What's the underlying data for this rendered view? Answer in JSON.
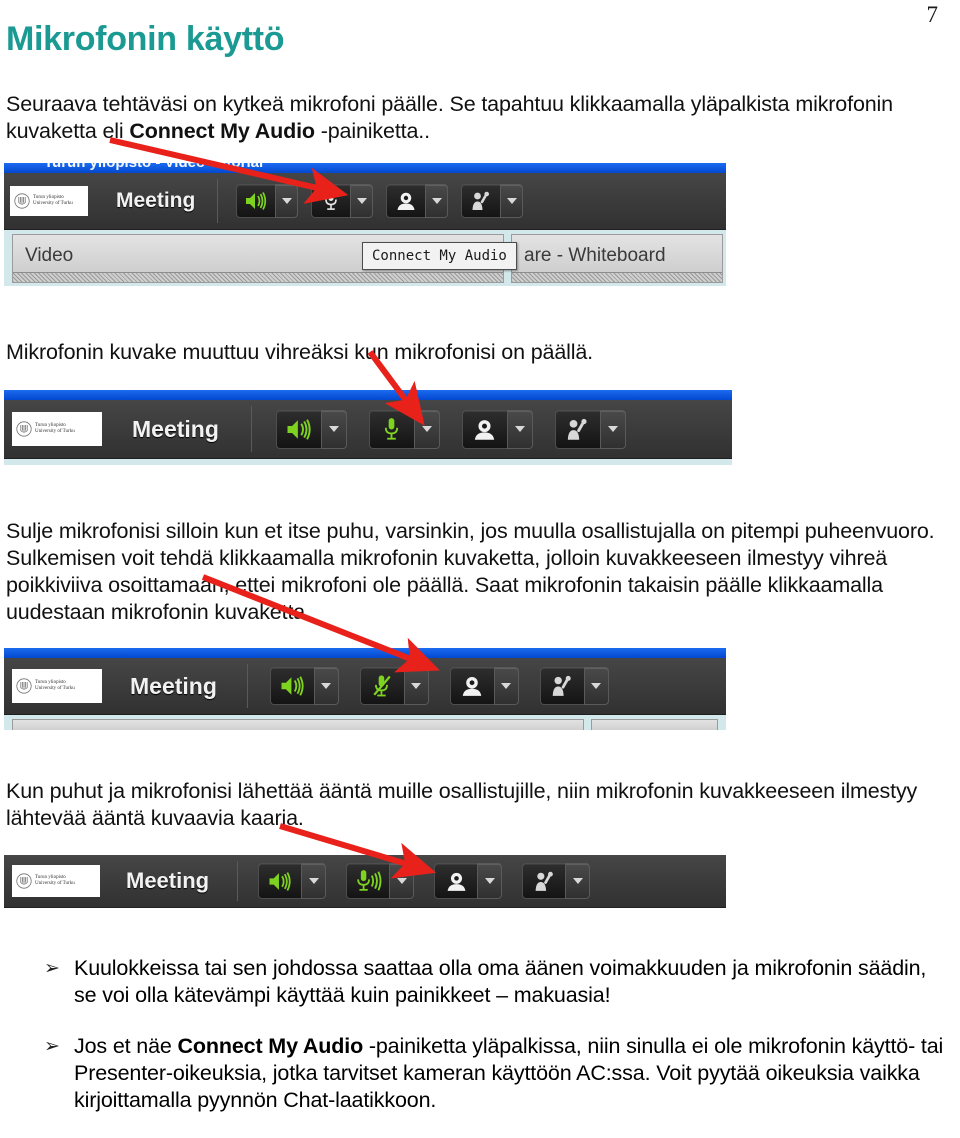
{
  "page": {
    "number": "7",
    "title": "Mikrofonin käyttö",
    "accent_color": "#1a9a92",
    "annotation_color": "#e8211a"
  },
  "paragraphs": {
    "intro_part1": "Seuraava tehtäväsi on kytkeä mikrofoni päälle. Se tapahtuu klikkaamalla yläpalkista mikrofonin kuvaketta eli ",
    "intro_bold": "Connect My Audio",
    "intro_part2": " -painiketta..",
    "green_icon": "Mikrofonin kuvake muuttuu vihreäksi kun mikrofonisi on päällä.",
    "closing": "Sulje mikrofonisi silloin kun et itse puhu, varsinkin, jos muulla osallistujalla on pitempi puheenvuoro. Sulkemisen voit tehdä klikkaamalla mikrofonin kuvaketta, jolloin kuvakkeeseen ilmestyy vihreä poikkiviiva osoittamaan, ettei mikrofoni ole päällä. Saat mikrofonin takaisin päälle klikkaamalla uudestaan mikrofonin kuvaketta.",
    "speaking": "Kun puhut ja mikrofonisi lähettää ääntä muille osallistujille, niin mikrofonin kuvakkeeseen ilmestyy lähtevää ääntä kuvaavia kaaria."
  },
  "bullets": [
    {
      "marker": "➢",
      "part1": "Kuulokkeissa tai sen johdossa saattaa olla oma äänen voimakkuuden ja mikrofonin säädin, se voi olla kätevämpi käyttää kuin painikkeet – makuasia!",
      "bold": "",
      "part2": ""
    },
    {
      "marker": "➢",
      "part1": "Jos et näe ",
      "bold": "Connect My Audio",
      "part2": " -painiketta yläpalkissa, niin sinulla ei ole mikrofonin käyttö- tai Presenter-oikeuksia, jotka tarvitset kameran käyttöön AC:ssa. Voit pyytää oikeuksia vaikka kirjoittamalla pyynnön Chat-laatikkoon."
    }
  ],
  "screenshots": [
    {
      "id": "shot1",
      "caption": "toolbar-mic-off",
      "window_title": "Turun yliopisto - Video Tutorial",
      "logo_line1": "Turun yliopisto",
      "logo_line2": "University of Turku",
      "meeting_label": "Meeting",
      "buttons": [
        {
          "name": "speaker",
          "state": "on"
        },
        {
          "name": "microphone",
          "state": "off"
        },
        {
          "name": "webcam",
          "state": "off"
        },
        {
          "name": "raise-hand",
          "state": "off"
        }
      ],
      "panels": [
        {
          "title": "Video"
        },
        {
          "title": "are - Whiteboard"
        }
      ],
      "tooltip": "Connect My Audio"
    },
    {
      "id": "shot2",
      "caption": "toolbar-mic-on-green",
      "logo_line1": "Turun yliopisto",
      "logo_line2": "University of Turku",
      "meeting_label": "Meeting",
      "buttons": [
        {
          "name": "speaker",
          "state": "on"
        },
        {
          "name": "microphone",
          "state": "on"
        },
        {
          "name": "webcam",
          "state": "off"
        },
        {
          "name": "raise-hand",
          "state": "off"
        }
      ]
    },
    {
      "id": "shot3",
      "caption": "toolbar-mic-muted",
      "logo_line1": "Turun yliopisto",
      "logo_line2": "University of Turku",
      "meeting_label": "Meeting",
      "buttons": [
        {
          "name": "speaker",
          "state": "on"
        },
        {
          "name": "microphone",
          "state": "muted"
        },
        {
          "name": "webcam",
          "state": "off"
        },
        {
          "name": "raise-hand",
          "state": "off"
        }
      ]
    },
    {
      "id": "shot4",
      "caption": "toolbar-mic-transmitting",
      "logo_line1": "Turun yliopisto",
      "logo_line2": "University of Turku",
      "meeting_label": "Meeting",
      "buttons": [
        {
          "name": "speaker",
          "state": "on"
        },
        {
          "name": "microphone",
          "state": "transmitting"
        },
        {
          "name": "webcam",
          "state": "off"
        },
        {
          "name": "raise-hand",
          "state": "off"
        }
      ]
    }
  ]
}
